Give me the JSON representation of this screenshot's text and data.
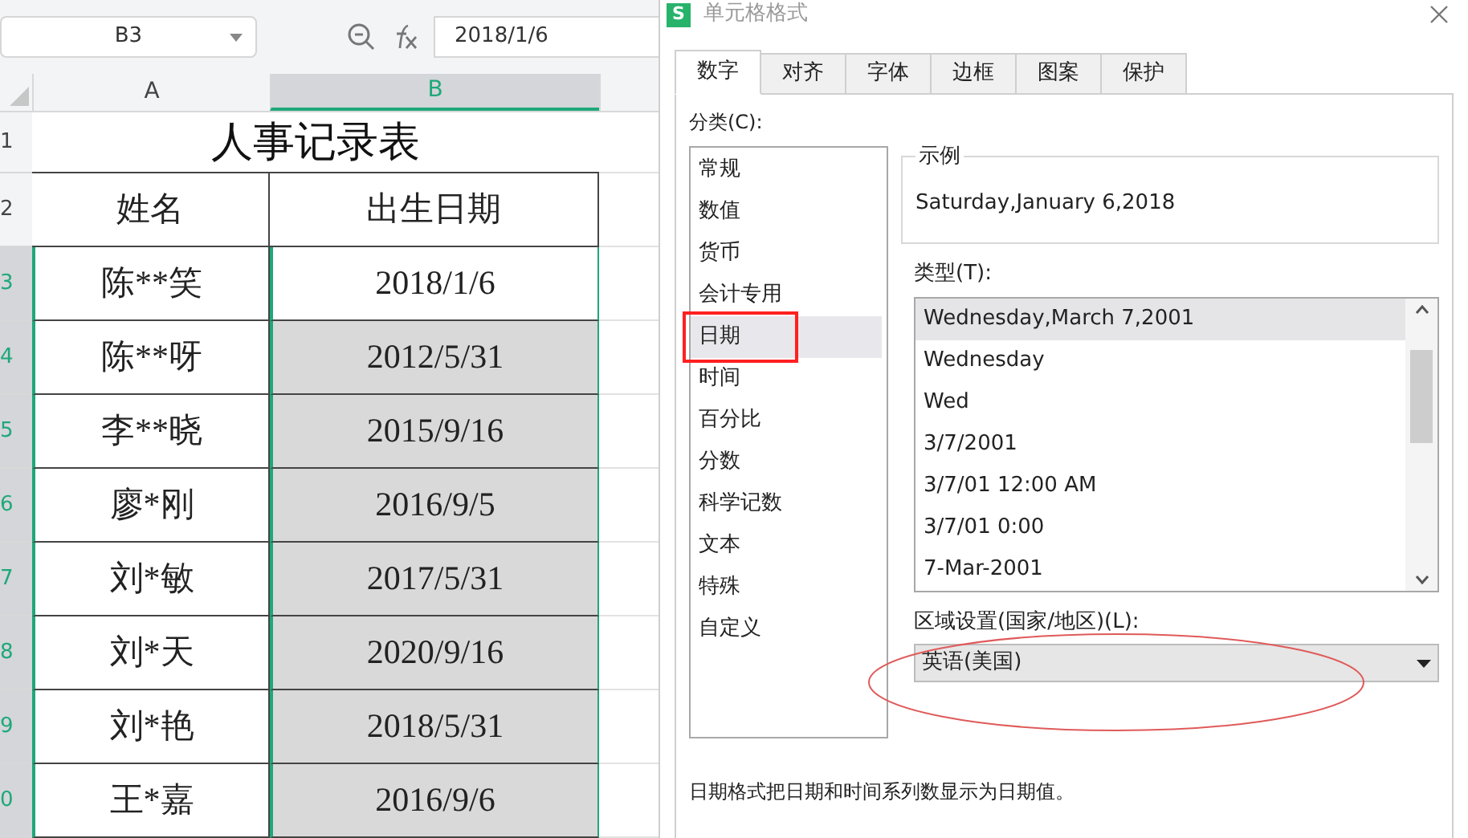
{
  "sheet": {
    "name_box": "B3",
    "formula": "2018/1/6",
    "columns": [
      {
        "label": "A",
        "selected": false
      },
      {
        "label": "B",
        "selected": true
      }
    ],
    "rows": [
      {
        "number": "1",
        "selected": false,
        "kind": "title",
        "cells": [
          "人事记录表"
        ]
      },
      {
        "number": "2",
        "selected": false,
        "kind": "header",
        "cells": [
          "姓名",
          "出生日期"
        ]
      },
      {
        "number": "3",
        "selected": true,
        "active": true,
        "kind": "data",
        "cells": [
          "陈**笑",
          "2018/1/6"
        ]
      },
      {
        "number": "4",
        "selected": true,
        "active": false,
        "kind": "data",
        "cells": [
          "陈**呀",
          "2012/5/31"
        ]
      },
      {
        "number": "5",
        "selected": true,
        "active": false,
        "kind": "data",
        "cells": [
          "李**晓",
          "2015/9/16"
        ]
      },
      {
        "number": "6",
        "selected": true,
        "active": false,
        "kind": "data",
        "cells": [
          "廖*刚",
          "2016/9/5"
        ]
      },
      {
        "number": "7",
        "selected": true,
        "active": false,
        "kind": "data",
        "cells": [
          "刘*敏",
          "2017/5/31"
        ]
      },
      {
        "number": "8",
        "selected": true,
        "active": false,
        "kind": "data",
        "cells": [
          "刘*天",
          "2020/9/16"
        ]
      },
      {
        "number": "9",
        "selected": true,
        "active": false,
        "kind": "data",
        "cells": [
          "刘*艳",
          "2018/5/31"
        ]
      },
      {
        "number": "0",
        "selected": true,
        "active": false,
        "kind": "data",
        "cells": [
          "王*嘉",
          "2016/9/6"
        ]
      }
    ]
  },
  "dialog": {
    "logo": "S",
    "title": "单元格格式",
    "tabs": [
      {
        "label": "数字",
        "selected": true
      },
      {
        "label": "对齐",
        "selected": false
      },
      {
        "label": "字体",
        "selected": false
      },
      {
        "label": "边框",
        "selected": false
      },
      {
        "label": "图案",
        "selected": false
      },
      {
        "label": "保护",
        "selected": false
      }
    ],
    "category_label": "分类(C):",
    "categories": [
      {
        "label": "常规",
        "selected": false
      },
      {
        "label": "数值",
        "selected": false
      },
      {
        "label": "货币",
        "selected": false
      },
      {
        "label": "会计专用",
        "selected": false
      },
      {
        "label": "日期",
        "selected": true
      },
      {
        "label": "时间",
        "selected": false
      },
      {
        "label": "百分比",
        "selected": false
      },
      {
        "label": "分数",
        "selected": false
      },
      {
        "label": "科学记数",
        "selected": false
      },
      {
        "label": "文本",
        "selected": false
      },
      {
        "label": "特殊",
        "selected": false
      },
      {
        "label": "自定义",
        "selected": false
      }
    ],
    "sample_label": "示例",
    "sample": "Saturday,January 6,2018",
    "type_label": "类型(T):",
    "types": [
      {
        "label": "Wednesday,March 7,2001",
        "selected": true
      },
      {
        "label": "Wednesday",
        "selected": false
      },
      {
        "label": "Wed",
        "selected": false
      },
      {
        "label": "3/7/2001",
        "selected": false
      },
      {
        "label": "3/7/01 12:00 AM",
        "selected": false
      },
      {
        "label": "3/7/01 0:00",
        "selected": false
      },
      {
        "label": "7-Mar-2001",
        "selected": false
      }
    ],
    "locale_label": "区域设置(国家/地区)(L):",
    "locale": "英语(美国)",
    "description": "日期格式把日期和时间系列数显示为日期值。"
  }
}
